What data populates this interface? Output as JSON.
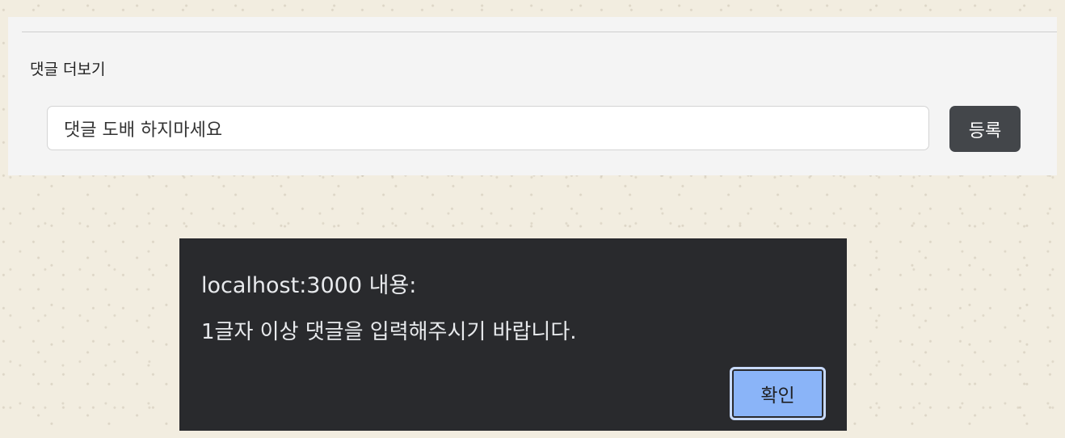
{
  "comments": {
    "more_label": "댓글 더보기",
    "input_value": "댓글 도배 하지마세요",
    "submit_label": "등록"
  },
  "alert": {
    "title": "localhost:3000 내용:",
    "message": "1글자 이상 댓글을 입력해주시기 바랍니다.",
    "ok_label": "확인"
  },
  "colors": {
    "page_background": "#f2ede0",
    "panel_background": "#f4f4f4",
    "submit_button": "#43464a",
    "dialog_background": "#292a2d",
    "ok_button": "#8ab4f8"
  }
}
